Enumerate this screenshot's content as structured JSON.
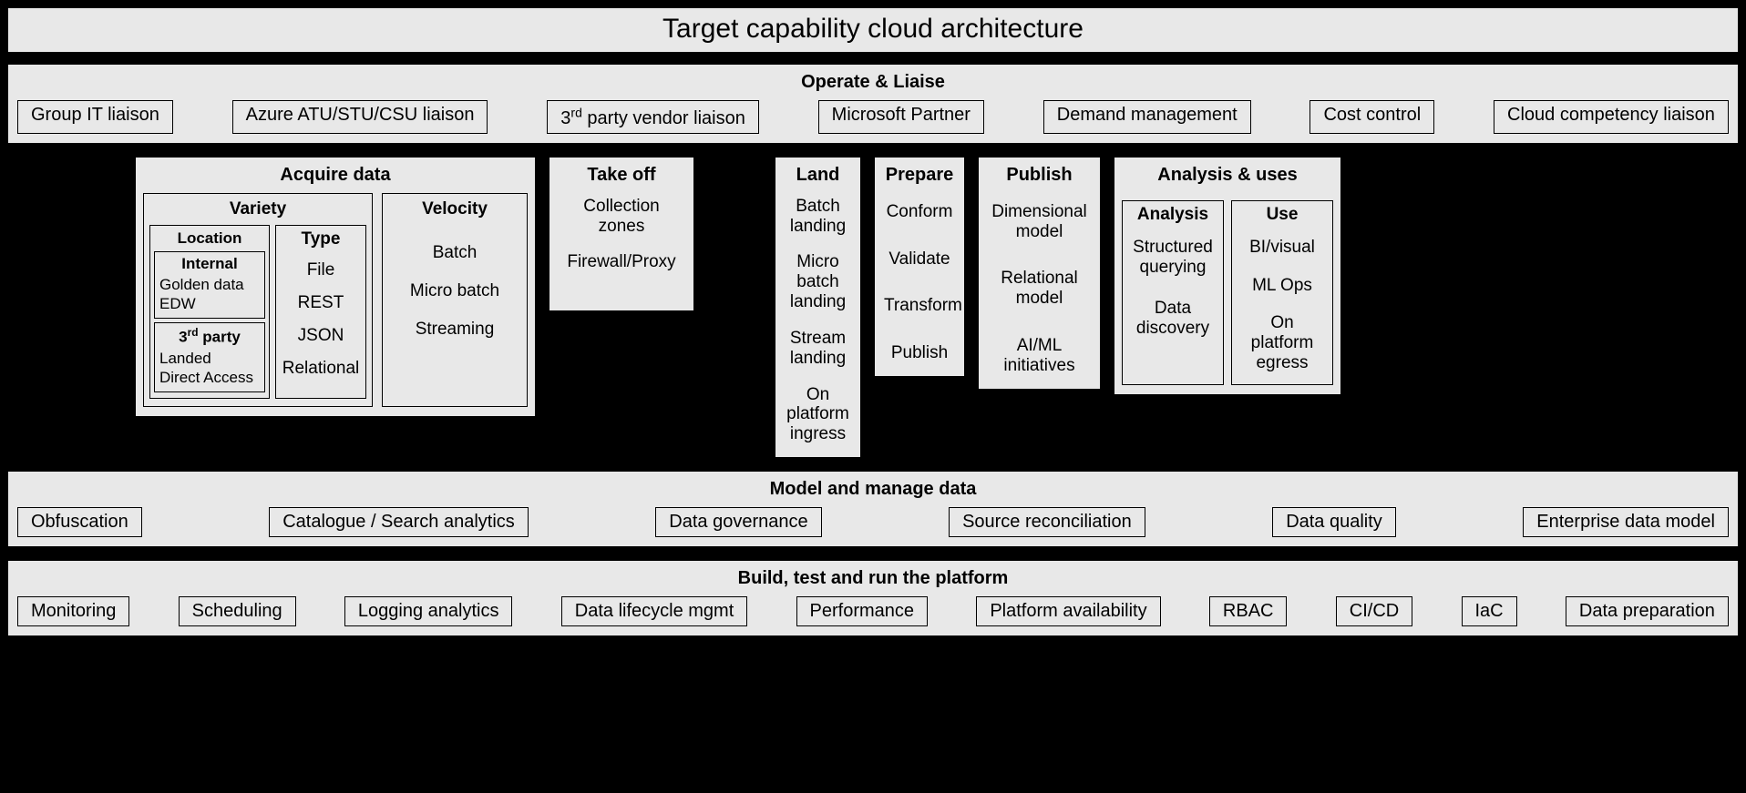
{
  "title": "Target capability cloud architecture",
  "operate": {
    "title": "Operate & Liaise",
    "items": [
      "Group IT liaison",
      "Azure ATU/STU/CSU liaison",
      "3rd party vendor liaison",
      "Microsoft Partner",
      "Demand management",
      "Cost control",
      "Cloud competency liaison"
    ]
  },
  "acquire": {
    "title": "Acquire data",
    "variety": {
      "title": "Variety",
      "location": {
        "title": "Location",
        "internal": {
          "title": "Internal",
          "items": [
            "Golden data",
            "EDW"
          ]
        },
        "third": {
          "title": "3rd party",
          "items": [
            "Landed",
            "Direct Access"
          ]
        }
      },
      "type": {
        "title": "Type",
        "items": [
          "File",
          "REST",
          "JSON",
          "Relational"
        ]
      }
    },
    "velocity": {
      "title": "Velocity",
      "items": [
        "Batch",
        "Micro batch",
        "Streaming"
      ]
    }
  },
  "takeoff": {
    "title": "Take off",
    "items": [
      "Collection zones",
      "Firewall/Proxy"
    ]
  },
  "land": {
    "title": "Land",
    "items": [
      "Batch landing",
      "Micro batch landing",
      "Stream landing",
      "On platform ingress"
    ]
  },
  "prepare": {
    "title": "Prepare",
    "items": [
      "Conform",
      "Validate",
      "Transform",
      "Publish"
    ]
  },
  "publish": {
    "title": "Publish",
    "items": [
      "Dimensional model",
      "Relational model",
      "AI/ML initiatives"
    ]
  },
  "analysis": {
    "title": "Analysis & uses",
    "analysis_col": {
      "title": "Analysis",
      "items": [
        "Structured querying",
        "Data discovery"
      ]
    },
    "use_col": {
      "title": "Use",
      "items": [
        "BI/visual",
        "ML Ops",
        "On platform egress"
      ]
    }
  },
  "model": {
    "title": "Model and manage data",
    "items": [
      "Obfuscation",
      "Catalogue / Search analytics",
      "Data governance",
      "Source reconciliation",
      "Data quality",
      "Enterprise data model"
    ]
  },
  "build": {
    "title": "Build, test and run the platform",
    "items": [
      "Monitoring",
      "Scheduling",
      "Logging analytics",
      "Data lifecycle mgmt",
      "Performance",
      "Platform availability",
      "RBAC",
      "CI/CD",
      "IaC",
      "Data preparation"
    ]
  }
}
